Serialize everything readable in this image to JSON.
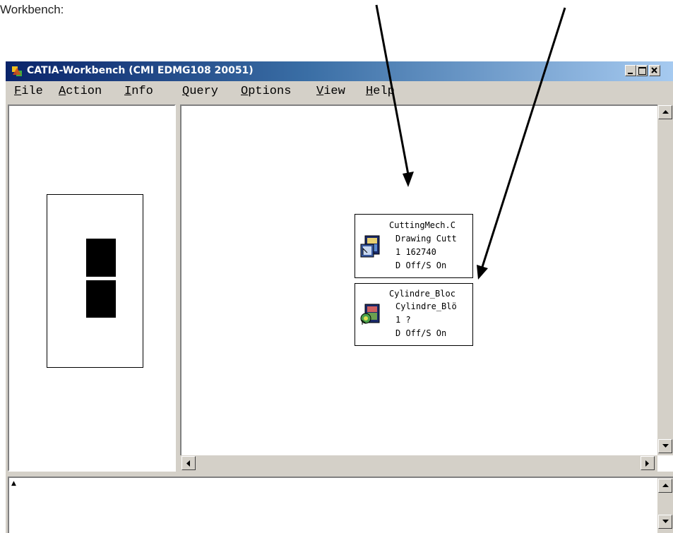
{
  "caption": "Workbench:",
  "window": {
    "title": "CATIA-Workbench (CMI EDMG108 20051)",
    "buttons": {
      "minimize": "_",
      "maximize": "□",
      "close": "×"
    }
  },
  "menu": {
    "items": [
      {
        "accel": "F",
        "rest": "ile"
      },
      {
        "accel": "A",
        "rest": "ction"
      },
      {
        "accel": "I",
        "rest": "nfo"
      },
      {
        "accel": "Q",
        "rest": "uery"
      },
      {
        "accel": "O",
        "rest": "ptions"
      },
      {
        "accel": "V",
        "rest": "iew"
      },
      {
        "accel": "H",
        "rest": "elp"
      }
    ]
  },
  "documents": [
    {
      "name": "CuttingMech.C",
      "type": "Drawing Cutt",
      "info": "1  162740",
      "status": "D Off/S On",
      "icon": "catia-drawing-icon"
    },
    {
      "name": "Cylindre_Bloc",
      "type": "Cylindre_Blö",
      "info": "1  ?",
      "status": "D Off/S On",
      "icon": "catia-part-icon"
    }
  ],
  "console": {
    "prompt": "▲"
  },
  "colors": {
    "titlebar_start": "#0a246a",
    "titlebar_end": "#a6caf0",
    "chrome": "#d4d0c8"
  },
  "annotation_arrows": 2
}
